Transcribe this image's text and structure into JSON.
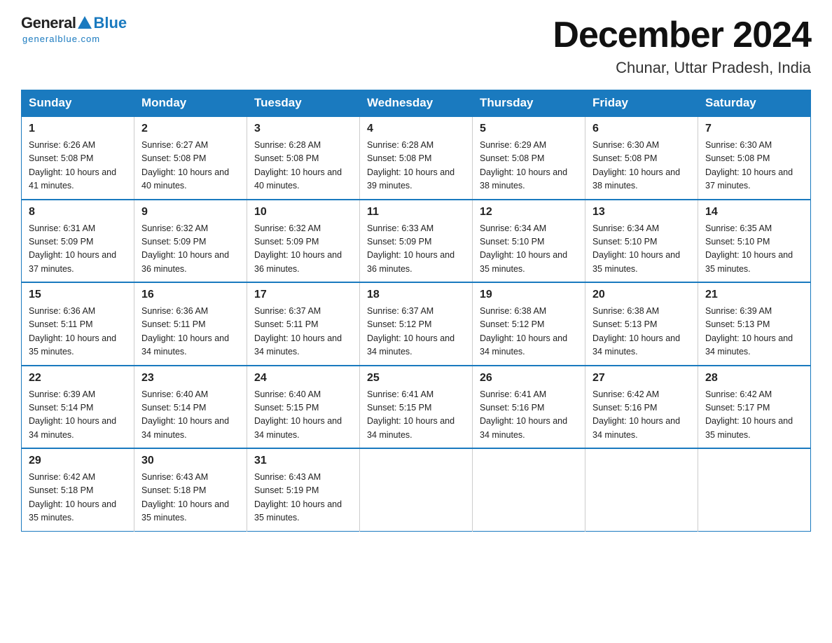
{
  "logo": {
    "general": "General",
    "blue": "Blue",
    "subtitle": "generalblue.com"
  },
  "title": "December 2024",
  "subtitle": "Chunar, Uttar Pradesh, India",
  "days_of_week": [
    "Sunday",
    "Monday",
    "Tuesday",
    "Wednesday",
    "Thursday",
    "Friday",
    "Saturday"
  ],
  "weeks": [
    [
      {
        "day": "1",
        "sunrise": "6:26 AM",
        "sunset": "5:08 PM",
        "daylight": "10 hours and 41 minutes."
      },
      {
        "day": "2",
        "sunrise": "6:27 AM",
        "sunset": "5:08 PM",
        "daylight": "10 hours and 40 minutes."
      },
      {
        "day": "3",
        "sunrise": "6:28 AM",
        "sunset": "5:08 PM",
        "daylight": "10 hours and 40 minutes."
      },
      {
        "day": "4",
        "sunrise": "6:28 AM",
        "sunset": "5:08 PM",
        "daylight": "10 hours and 39 minutes."
      },
      {
        "day": "5",
        "sunrise": "6:29 AM",
        "sunset": "5:08 PM",
        "daylight": "10 hours and 38 minutes."
      },
      {
        "day": "6",
        "sunrise": "6:30 AM",
        "sunset": "5:08 PM",
        "daylight": "10 hours and 38 minutes."
      },
      {
        "day": "7",
        "sunrise": "6:30 AM",
        "sunset": "5:08 PM",
        "daylight": "10 hours and 37 minutes."
      }
    ],
    [
      {
        "day": "8",
        "sunrise": "6:31 AM",
        "sunset": "5:09 PM",
        "daylight": "10 hours and 37 minutes."
      },
      {
        "day": "9",
        "sunrise": "6:32 AM",
        "sunset": "5:09 PM",
        "daylight": "10 hours and 36 minutes."
      },
      {
        "day": "10",
        "sunrise": "6:32 AM",
        "sunset": "5:09 PM",
        "daylight": "10 hours and 36 minutes."
      },
      {
        "day": "11",
        "sunrise": "6:33 AM",
        "sunset": "5:09 PM",
        "daylight": "10 hours and 36 minutes."
      },
      {
        "day": "12",
        "sunrise": "6:34 AM",
        "sunset": "5:10 PM",
        "daylight": "10 hours and 35 minutes."
      },
      {
        "day": "13",
        "sunrise": "6:34 AM",
        "sunset": "5:10 PM",
        "daylight": "10 hours and 35 minutes."
      },
      {
        "day": "14",
        "sunrise": "6:35 AM",
        "sunset": "5:10 PM",
        "daylight": "10 hours and 35 minutes."
      }
    ],
    [
      {
        "day": "15",
        "sunrise": "6:36 AM",
        "sunset": "5:11 PM",
        "daylight": "10 hours and 35 minutes."
      },
      {
        "day": "16",
        "sunrise": "6:36 AM",
        "sunset": "5:11 PM",
        "daylight": "10 hours and 34 minutes."
      },
      {
        "day": "17",
        "sunrise": "6:37 AM",
        "sunset": "5:11 PM",
        "daylight": "10 hours and 34 minutes."
      },
      {
        "day": "18",
        "sunrise": "6:37 AM",
        "sunset": "5:12 PM",
        "daylight": "10 hours and 34 minutes."
      },
      {
        "day": "19",
        "sunrise": "6:38 AM",
        "sunset": "5:12 PM",
        "daylight": "10 hours and 34 minutes."
      },
      {
        "day": "20",
        "sunrise": "6:38 AM",
        "sunset": "5:13 PM",
        "daylight": "10 hours and 34 minutes."
      },
      {
        "day": "21",
        "sunrise": "6:39 AM",
        "sunset": "5:13 PM",
        "daylight": "10 hours and 34 minutes."
      }
    ],
    [
      {
        "day": "22",
        "sunrise": "6:39 AM",
        "sunset": "5:14 PM",
        "daylight": "10 hours and 34 minutes."
      },
      {
        "day": "23",
        "sunrise": "6:40 AM",
        "sunset": "5:14 PM",
        "daylight": "10 hours and 34 minutes."
      },
      {
        "day": "24",
        "sunrise": "6:40 AM",
        "sunset": "5:15 PM",
        "daylight": "10 hours and 34 minutes."
      },
      {
        "day": "25",
        "sunrise": "6:41 AM",
        "sunset": "5:15 PM",
        "daylight": "10 hours and 34 minutes."
      },
      {
        "day": "26",
        "sunrise": "6:41 AM",
        "sunset": "5:16 PM",
        "daylight": "10 hours and 34 minutes."
      },
      {
        "day": "27",
        "sunrise": "6:42 AM",
        "sunset": "5:16 PM",
        "daylight": "10 hours and 34 minutes."
      },
      {
        "day": "28",
        "sunrise": "6:42 AM",
        "sunset": "5:17 PM",
        "daylight": "10 hours and 35 minutes."
      }
    ],
    [
      {
        "day": "29",
        "sunrise": "6:42 AM",
        "sunset": "5:18 PM",
        "daylight": "10 hours and 35 minutes."
      },
      {
        "day": "30",
        "sunrise": "6:43 AM",
        "sunset": "5:18 PM",
        "daylight": "10 hours and 35 minutes."
      },
      {
        "day": "31",
        "sunrise": "6:43 AM",
        "sunset": "5:19 PM",
        "daylight": "10 hours and 35 minutes."
      },
      null,
      null,
      null,
      null
    ]
  ],
  "labels": {
    "sunrise": "Sunrise:",
    "sunset": "Sunset:",
    "daylight": "Daylight:"
  },
  "accent_color": "#1a7abf"
}
